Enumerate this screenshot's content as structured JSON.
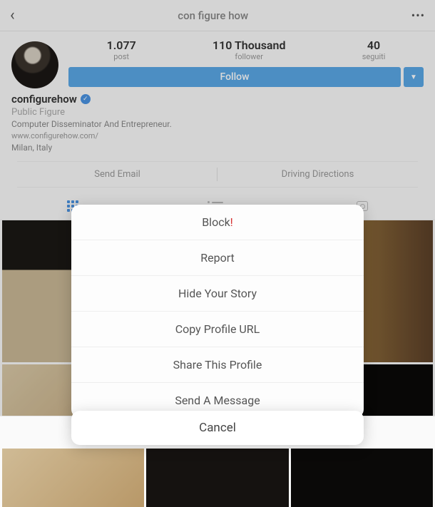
{
  "header": {
    "title": "con figure how"
  },
  "stats": {
    "posts": {
      "num": "1.077",
      "label": "post"
    },
    "followers": {
      "num": "110 Thousand",
      "label": "follower"
    },
    "following": {
      "num": "40",
      "label": "seguiti"
    }
  },
  "follow_btn": "Follow",
  "profile": {
    "username": "configurehow",
    "role": "Public Figure",
    "bio": "Computer Disseminator And Entrepreneur.",
    "site": "www.configurehow.com/",
    "location": "Milan, Italy"
  },
  "actions": {
    "email": "Send Email",
    "directions": "Driving Directions"
  },
  "sheet": {
    "block": "Block",
    "report": "Report",
    "hide": "Hide Your Story",
    "copy": "Copy Profile URL",
    "share": "Share This Profile",
    "message": "Send A Message"
  },
  "cancel": "Cancel"
}
